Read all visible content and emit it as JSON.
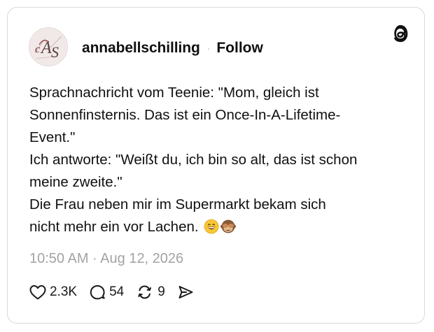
{
  "user": {
    "avatar_initials": "cAS",
    "username": "annabellschilling",
    "separator": "·",
    "follow_label": "Follow"
  },
  "post": {
    "lines": [
      "Sprachnachricht vom Teenie: \"Mom, gleich ist",
      "Sonnenfinsternis. Das ist ein Once-In-A-Lifetime-",
      "Event.\"",
      "Ich antworte: \"Weißt du, ich bin so alt, das ist schon",
      "meine zweite.\"",
      "Die Frau neben mir im Supermarkt bekam sich",
      "nicht mehr ein vor Lachen."
    ],
    "emojis": [
      "grinning-face-emoji",
      "see-no-evil-monkey-emoji"
    ],
    "timestamp": "10:50 AM · Aug 12, 2026"
  },
  "actions": {
    "likes": "2.3K",
    "replies": "54",
    "reposts": "9"
  },
  "icons": [
    "threads-logo-icon",
    "heart-icon",
    "comment-icon",
    "repost-icon",
    "share-icon"
  ],
  "colors": {
    "text": "#101010",
    "muted": "#a3a3a3",
    "border": "#d9d9d9"
  }
}
